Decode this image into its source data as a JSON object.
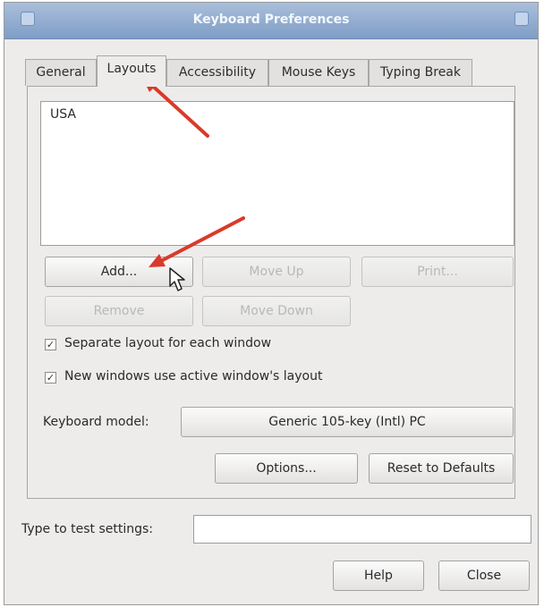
{
  "window": {
    "title": "Keyboard Preferences"
  },
  "tabs": [
    {
      "label": "General",
      "active": false
    },
    {
      "label": "Layouts",
      "active": true
    },
    {
      "label": "Accessibility",
      "active": false
    },
    {
      "label": "Mouse Keys",
      "active": false
    },
    {
      "label": "Typing Break",
      "active": false
    }
  ],
  "layouts_list": {
    "items": [
      "USA"
    ]
  },
  "buttons": {
    "add": "Add...",
    "move_up": "Move Up",
    "print": "Print...",
    "remove": "Remove",
    "move_down": "Move Down",
    "options": "Options...",
    "reset": "Reset to Defaults",
    "help": "Help",
    "close": "Close"
  },
  "checkboxes": {
    "separate_layout": {
      "label": "Separate layout for each window",
      "checked": true
    },
    "new_windows": {
      "label": "New windows use active window's layout",
      "checked": true
    }
  },
  "keyboard_model": {
    "label": "Keyboard model:",
    "value": "Generic 105-key (Intl) PC"
  },
  "test_settings": {
    "label": "Type to test settings:",
    "value": ""
  },
  "annotation": {
    "arrow_color": "#d93a2b"
  }
}
